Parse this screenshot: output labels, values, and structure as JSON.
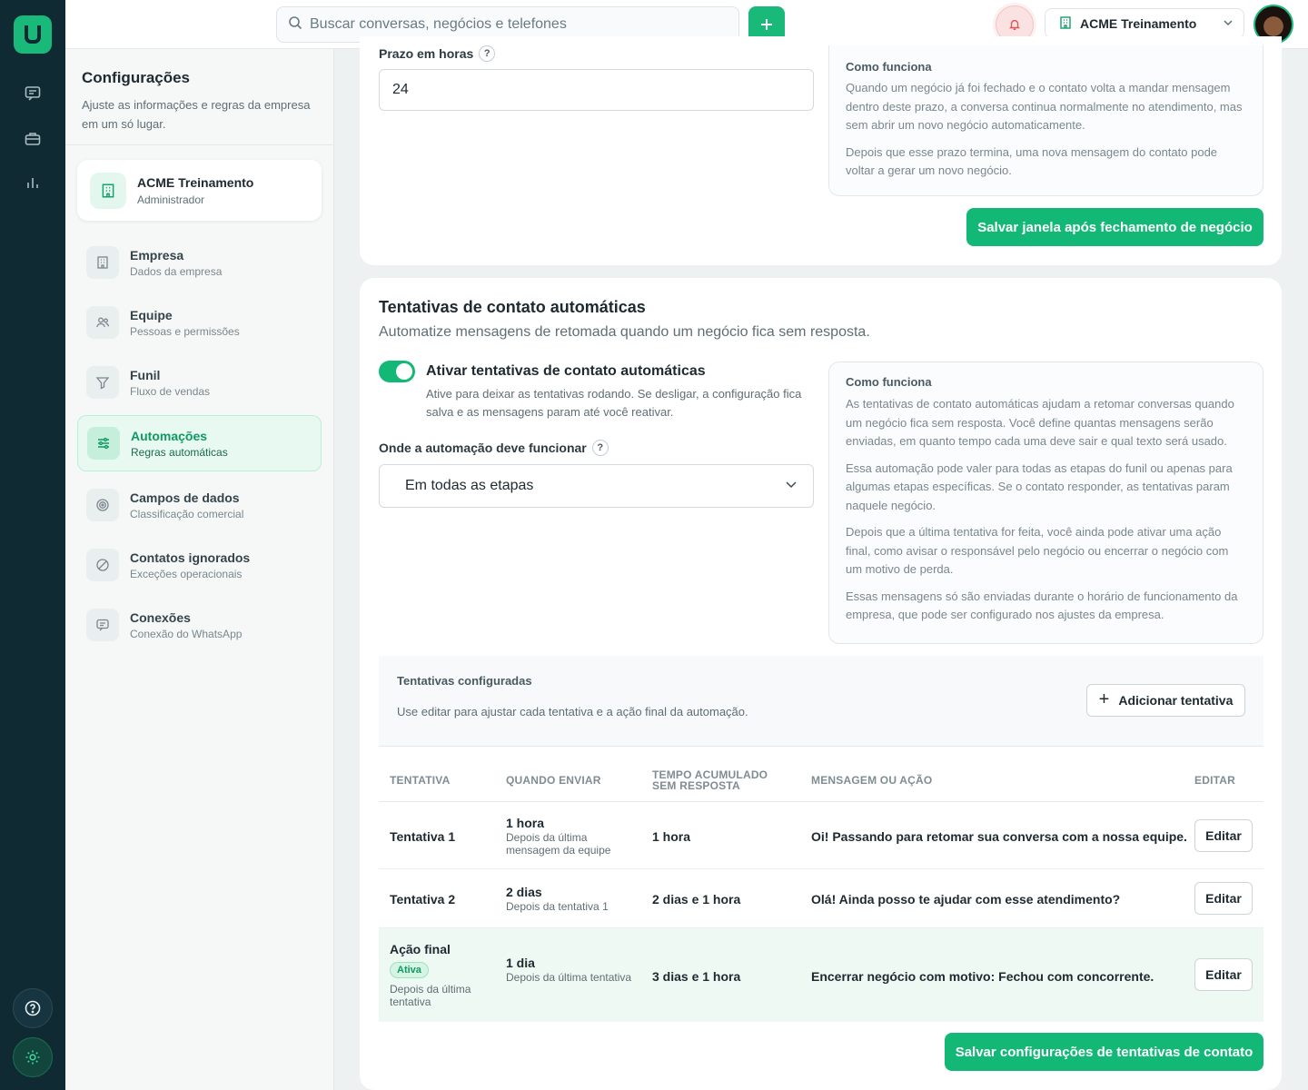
{
  "topbar": {
    "search_placeholder": "Buscar conversas, negócios e telefones",
    "company": "ACME Treinamento"
  },
  "settings": {
    "title": "Configurações",
    "subtitle": "Ajuste as informações e regras da empresa em um só lugar.",
    "org": {
      "name": "ACME Treinamento",
      "role": "Administrador"
    },
    "nav": [
      {
        "label": "Empresa",
        "desc": "Dados da empresa",
        "icon": "building-icon"
      },
      {
        "label": "Equipe",
        "desc": "Pessoas e permissões",
        "icon": "users-icon"
      },
      {
        "label": "Funil",
        "desc": "Fluxo de vendas",
        "icon": "funnel-icon"
      },
      {
        "label": "Automações",
        "desc": "Regras automáticas",
        "icon": "sliders-icon",
        "active": true
      },
      {
        "label": "Campos de dados",
        "desc": "Classificação comercial",
        "icon": "target-icon"
      },
      {
        "label": "Contatos ignorados",
        "desc": "Exceções operacionais",
        "icon": "ban-icon"
      },
      {
        "label": "Conexões",
        "desc": "Conexão do WhatsApp",
        "icon": "chat-icon"
      }
    ]
  },
  "window_section": {
    "deadline_label": "Prazo em horas",
    "deadline_value": "24",
    "info_title": "Como funciona",
    "info_p1": "Quando um negócio já foi fechado e o contato volta a mandar mensagem dentro deste prazo, a conversa continua normalmente no atendimento, mas sem abrir um novo negócio automaticamente.",
    "info_p2": "Depois que esse prazo termina, uma nova mensagem do contato pode voltar a gerar um novo negócio.",
    "save_label": "Salvar janela após fechamento de negócio"
  },
  "attempts_section": {
    "title": "Tentativas de contato automáticas",
    "subtitle": "Automatize mensagens de retomada quando um negócio fica sem resposta.",
    "toggle_label": "Ativar tentativas de contato automáticas",
    "toggle_on": true,
    "toggle_desc": "Ative para deixar as tentativas rodando. Se desligar, a configuração fica salva e as mensagens param até você reativar.",
    "scope_label": "Onde a automação deve funcionar",
    "scope_value": "Em todas as etapas",
    "info_title": "Como funciona",
    "info_p1": "As tentativas de contato automáticas ajudam a retomar conversas quando um negócio fica sem resposta. Você define quantas mensagens serão enviadas, em quanto tempo cada uma deve sair e qual texto será usado.",
    "info_p2": "Essa automação pode valer para todas as etapas do funil ou apenas para algumas etapas específicas. Se o contato responder, as tentativas param naquele negócio.",
    "info_p3": "Depois que a última tentativa for feita, você ainda pode ativar uma ação final, como avisar o responsável pelo negócio ou encerrar o negócio com um motivo de perda.",
    "info_p4": "Essas mensagens só são enviadas durante o horário de funcionamento da empresa, que pode ser configurado nos ajustes da empresa.",
    "configured_title": "Tentativas configuradas",
    "configured_sub": "Use editar para ajustar cada tentativa e a ação final da automação.",
    "add_label": "Adicionar tentativa",
    "columns": {
      "attempt": "TENTATIVA",
      "when": "QUANDO ENVIAR",
      "accum_1": "TEMPO ACUMULADO",
      "accum_2": "SEM RESPOSTA",
      "message": "MENSAGEM OU AÇÃO",
      "edit": "EDITAR"
    },
    "rows": [
      {
        "name": "Tentativa 1",
        "when": "1 hora",
        "when_sub": "Depois da última mensagem da equipe",
        "accum": "1 hora",
        "message": "Oi! Passando para retomar sua conversa com a nossa equipe.",
        "edit": "Editar"
      },
      {
        "name": "Tentativa 2",
        "when": "2 dias",
        "when_sub": "Depois da tentativa 1",
        "accum": "2 dias e 1 hora",
        "message": "Olá! Ainda posso te ajudar com esse atendimento?",
        "edit": "Editar"
      },
      {
        "name": "Ação final",
        "badge": "Ativa",
        "name_sub": "Depois da última tentativa",
        "when": "1 dia",
        "when_sub": "Depois da última tentativa",
        "accum": "3 dias e 1 hora",
        "message": "Encerrar negócio com motivo: Fechou com concorrente.",
        "edit": "Editar"
      }
    ],
    "save_label": "Salvar configurações de tentativas de contato"
  },
  "colors": {
    "accent": "#14b876",
    "rail": "#0f2a33",
    "active_bg": "#e7f9f0"
  }
}
